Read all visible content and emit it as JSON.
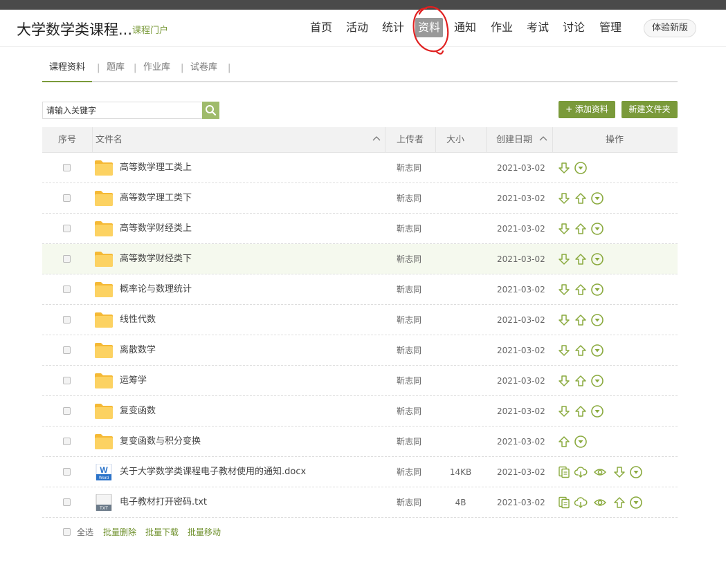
{
  "header": {
    "course_title": "大学数学类课程...",
    "portal_link": "课程门户",
    "nav": [
      "首页",
      "活动",
      "统计",
      "资料",
      "通知",
      "作业",
      "考试",
      "讨论",
      "管理"
    ],
    "active_nav": "资料",
    "try_new": "体验新版"
  },
  "subtabs": {
    "items": [
      "课程资料",
      "题库",
      "作业库",
      "试卷库"
    ],
    "separator": "|"
  },
  "toolbar": {
    "search_placeholder": "请输入关键字",
    "add_button": "+ 添加资料",
    "new_folder_button": "新建文件夹"
  },
  "table": {
    "headers": {
      "index": "序号",
      "name": "文件名",
      "uploader": "上传者",
      "size": "大小",
      "date": "创建日期",
      "ops": "操作"
    },
    "rows": [
      {
        "name": "高等数学理工类上",
        "type": "folder",
        "uploader": "靳志同",
        "size": "",
        "date": "2021-03-02",
        "ops": [
          "download",
          "more"
        ]
      },
      {
        "name": "高等数学理工类下",
        "type": "folder",
        "uploader": "靳志同",
        "size": "",
        "date": "2021-03-02",
        "ops": [
          "download",
          "up",
          "more"
        ]
      },
      {
        "name": "高等数学财经类上",
        "type": "folder",
        "uploader": "靳志同",
        "size": "",
        "date": "2021-03-02",
        "ops": [
          "download",
          "up",
          "more"
        ]
      },
      {
        "name": "高等数学财经类下",
        "type": "folder",
        "uploader": "靳志同",
        "size": "",
        "date": "2021-03-02",
        "ops": [
          "download",
          "up",
          "more"
        ],
        "highlight": true
      },
      {
        "name": "概率论与数理统计",
        "type": "folder",
        "uploader": "靳志同",
        "size": "",
        "date": "2021-03-02",
        "ops": [
          "download",
          "up",
          "more"
        ]
      },
      {
        "name": "线性代数",
        "type": "folder",
        "uploader": "靳志同",
        "size": "",
        "date": "2021-03-02",
        "ops": [
          "download",
          "up",
          "more"
        ]
      },
      {
        "name": "离散数学",
        "type": "folder",
        "uploader": "靳志同",
        "size": "",
        "date": "2021-03-02",
        "ops": [
          "download",
          "up",
          "more"
        ]
      },
      {
        "name": "运筹学",
        "type": "folder",
        "uploader": "靳志同",
        "size": "",
        "date": "2021-03-02",
        "ops": [
          "download",
          "up",
          "more"
        ]
      },
      {
        "name": "复变函数",
        "type": "folder",
        "uploader": "靳志同",
        "size": "",
        "date": "2021-03-02",
        "ops": [
          "download",
          "up",
          "more"
        ]
      },
      {
        "name": "复变函数与积分变换",
        "type": "folder",
        "uploader": "靳志同",
        "size": "",
        "date": "2021-03-02",
        "ops": [
          "up",
          "more"
        ]
      },
      {
        "name": "关于大学数学类课程电子教材使用的通知.docx",
        "type": "word",
        "uploader": "靳志同",
        "size": "14KB",
        "date": "2021-03-02",
        "ops": [
          "copy",
          "cloud-download",
          "preview",
          "download",
          "more"
        ]
      },
      {
        "name": "电子教材打开密码.txt",
        "type": "txt",
        "uploader": "靳志同",
        "size": "4B",
        "date": "2021-03-02",
        "ops": [
          "copy",
          "cloud-download",
          "preview",
          "up",
          "more"
        ]
      }
    ]
  },
  "footer": {
    "select_all": "全选",
    "batch_delete": "批量删除",
    "batch_download": "批量下载",
    "batch_move": "批量移动"
  },
  "colors": {
    "accent": "#7a9a3a",
    "search_button": "#9fbb6b",
    "folder": "#f9c94b",
    "highlight_row": "#f5f9ee",
    "annotation_circle": "#e02020"
  },
  "icons": {
    "word_label": "W",
    "word_caption": "Word",
    "txt_label": "TXT"
  }
}
